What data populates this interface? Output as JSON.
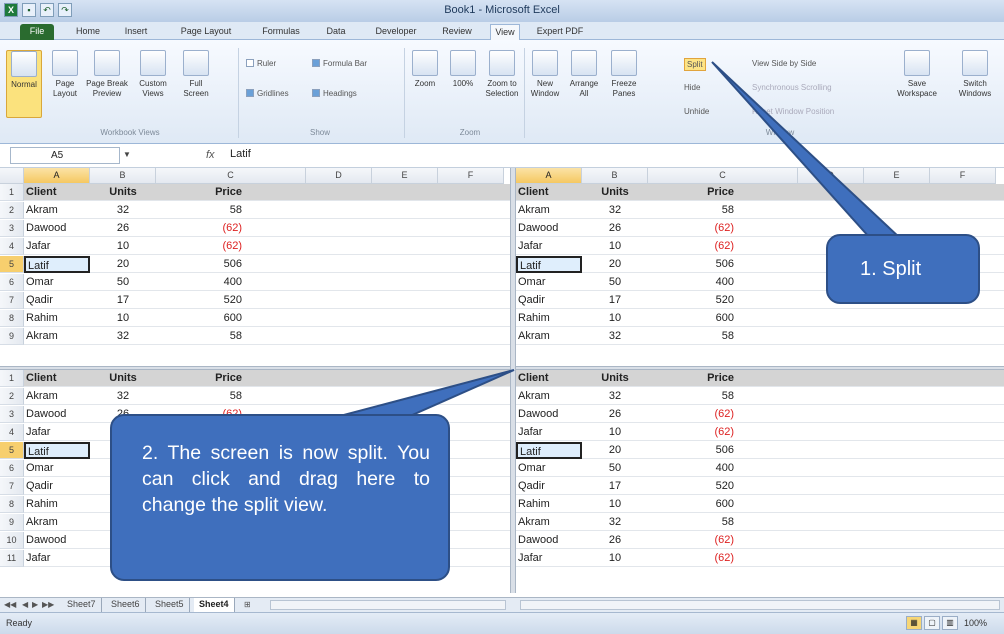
{
  "window": {
    "title": "Book1 - Microsoft Excel"
  },
  "ribbon_tabs": [
    "File",
    "Home",
    "Insert",
    "Page Layout",
    "Formulas",
    "Data",
    "Developer",
    "Review",
    "View",
    "Expert PDF"
  ],
  "ribbon": {
    "workbook_views": {
      "normal": "Normal",
      "page_layout": "Page Layout",
      "page_break": "Page Break Preview",
      "custom_views": "Custom Views",
      "full_screen": "Full Screen",
      "group": "Workbook Views"
    },
    "show": {
      "ruler": "Ruler",
      "gridlines": "Gridlines",
      "formula_bar": "Formula Bar",
      "headings": "Headings",
      "group": "Show"
    },
    "zoom": {
      "zoom": "Zoom",
      "zoom100": "100%",
      "zoom_selection": "Zoom to Selection",
      "group": "Zoom"
    },
    "window": {
      "new_window": "New Window",
      "arrange_all": "Arrange All",
      "freeze_panes": "Freeze Panes",
      "split": "Split",
      "hide": "Hide",
      "unhide": "Unhide",
      "view_side": "View Side by Side",
      "sync_scroll": "Synchronous Scrolling",
      "reset_pos": "Reset Window Position",
      "save_workspace": "Save Workspace",
      "switch_windows": "Switch Windows",
      "group": "Window"
    }
  },
  "formula_bar": {
    "name_box": "A5",
    "fx": "fx",
    "value": "Latif"
  },
  "columns": [
    "A",
    "B",
    "C",
    "D",
    "E",
    "F"
  ],
  "table": {
    "headers": [
      "Client",
      "Units",
      "Price"
    ],
    "rows": [
      [
        "Akram",
        "32",
        "58"
      ],
      [
        "Dawood",
        "26",
        "(62)"
      ],
      [
        "Jafar",
        "10",
        "(62)"
      ],
      [
        "Latif",
        "20",
        "506"
      ],
      [
        "Omar",
        "50",
        "400"
      ],
      [
        "Qadir",
        "17",
        "520"
      ],
      [
        "Rahim",
        "10",
        "600"
      ],
      [
        "Akram",
        "32",
        "58"
      ],
      [
        "Dawood",
        "26",
        "(62)"
      ],
      [
        "Jafar",
        "10",
        "(62)"
      ]
    ]
  },
  "row_numbers": [
    "1",
    "2",
    "3",
    "4",
    "5",
    "6",
    "7",
    "8",
    "9",
    "10",
    "11"
  ],
  "sheet_tabs": [
    "Sheet7",
    "Sheet6",
    "Sheet5",
    "Sheet4"
  ],
  "active_sheet": "Sheet4",
  "status": {
    "text": "Ready",
    "zoom": "100%"
  },
  "callouts": {
    "split": "1. Split",
    "screen_split": "2. The screen is now split. You can click and drag here to change the split view."
  },
  "colors": {
    "callout": "#3f6fbd",
    "negative": "#dd2222",
    "header_fill": "#d4d4d4",
    "active_header": "#f5c862"
  }
}
